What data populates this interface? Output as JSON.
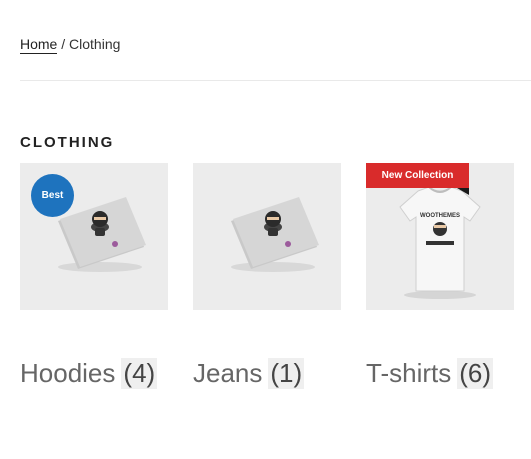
{
  "breadcrumb": {
    "home": "Home",
    "separator": " / ",
    "current": "Clothing"
  },
  "section": {
    "title": "CLOTHING"
  },
  "categories": [
    {
      "name": "Hoodies",
      "count": "(4)",
      "badge": "Best",
      "image": "ninja-poster-image"
    },
    {
      "name": "Jeans",
      "count": "(1)",
      "badge": "",
      "image": "ninja-poster-image"
    },
    {
      "name": "T-shirts",
      "count": "(6)",
      "badge": "New Collection",
      "image": "woothemes-tshirt-image",
      "tshirt_text": "WOOTHEMES"
    }
  ],
  "colors": {
    "best_badge": "#1e73be",
    "new_badge": "#d92b2b",
    "tile_bg": "#ececec"
  }
}
